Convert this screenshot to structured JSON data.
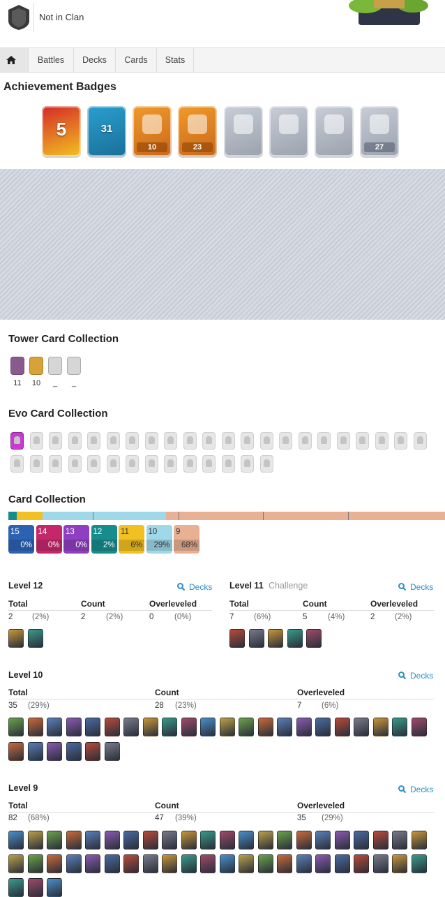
{
  "profile": {
    "clan_label": "Not in Clan"
  },
  "nav": {
    "tabs": [
      {
        "label": "Battles"
      },
      {
        "label": "Decks"
      },
      {
        "label": "Cards"
      },
      {
        "label": "Stats"
      }
    ]
  },
  "achievements": {
    "title": "Achievement Badges",
    "badges": [
      {
        "name": "years-played-badge",
        "value": "5",
        "strip": "",
        "colors": [
          "#d42a2a",
          "#f2c21f"
        ]
      },
      {
        "name": "level-badge",
        "value": "31",
        "strip": "",
        "colors": [
          "#2a9fcf",
          "#1a6f99"
        ]
      },
      {
        "name": "cards-badge",
        "value": "",
        "strip": "10",
        "colors": [
          "#f09a2a",
          "#c9681a"
        ]
      },
      {
        "name": "crown-badge",
        "value": "",
        "strip": "23",
        "colors": [
          "#f09a2a",
          "#c9681a"
        ]
      },
      {
        "name": "king-tower-badge",
        "value": "",
        "strip": "",
        "colors": [
          "#c8cdd6",
          "#9aa2ae"
        ]
      },
      {
        "name": "collection-badge",
        "value": "",
        "strip": "",
        "colors": [
          "#c8cdd6",
          "#9aa2ae"
        ]
      },
      {
        "name": "medal-badge",
        "value": "",
        "strip": "",
        "colors": [
          "#c8cdd6",
          "#9aa2ae"
        ]
      },
      {
        "name": "deck-badge",
        "value": "",
        "strip": "27",
        "colors": [
          "#c8cdd6",
          "#9aa2ae"
        ]
      }
    ]
  },
  "tower": {
    "title": "Tower Card Collection",
    "cards": [
      {
        "label": "11",
        "color": "#8a5a8f"
      },
      {
        "label": "10",
        "color": "#d8a23a"
      },
      {
        "label": "_",
        "color": "#d6d6d6"
      },
      {
        "label": "_",
        "color": "#d6d6d6"
      }
    ]
  },
  "evo": {
    "title": "Evo Card Collection",
    "owned_color": "#c93ad0"
  },
  "collection": {
    "title": "Card Collection",
    "bar": [
      {
        "level": "15",
        "share": 0.0,
        "color": "#2d62b3"
      },
      {
        "level": "14",
        "share": 0.0,
        "color": "#c4286a"
      },
      {
        "level": "13",
        "share": 0.0,
        "color": "#8f3fc2"
      },
      {
        "level": "12",
        "share": 0.02,
        "color": "#178c8c"
      },
      {
        "level": "11",
        "share": 0.06,
        "color": "#f3c021"
      },
      {
        "level": "10",
        "share": 0.29,
        "color": "#9fd8e8"
      },
      {
        "level": "9",
        "share": 0.68,
        "color": "#e9b193"
      }
    ],
    "boxes": [
      {
        "level": "15",
        "pct": "0%",
        "color": "#2d62b3"
      },
      {
        "level": "14",
        "pct": "0%",
        "color": "#c4286a"
      },
      {
        "level": "13",
        "pct": "0%",
        "color": "#8f3fc2"
      },
      {
        "level": "12",
        "pct": "2%",
        "color": "#178c8c"
      },
      {
        "level": "11",
        "pct": "6%",
        "color": "#f3c021"
      },
      {
        "level": "10",
        "pct": "29%",
        "color": "#9fd8e8"
      },
      {
        "level": "9",
        "pct": "68%",
        "color": "#e9b193"
      }
    ]
  },
  "levels": {
    "decks_label": "Decks",
    "total_label": "Total",
    "count_label": "Count",
    "over_label": "Overleveled",
    "l12": {
      "title": "Level 12",
      "total": "2",
      "total_pct": "(2%)",
      "count": "2",
      "count_pct": "(2%)",
      "over": "0",
      "over_pct": "(0%)"
    },
    "l11": {
      "title": "Level 11",
      "sub": "Challenge",
      "total": "7",
      "total_pct": "(6%)",
      "count": "5",
      "count_pct": "(4%)",
      "over": "2",
      "over_pct": "(2%)"
    },
    "l10": {
      "title": "Level 10",
      "total": "35",
      "total_pct": "(29%)",
      "count": "28",
      "count_pct": "(23%)",
      "over": "7",
      "over_pct": "(6%)"
    },
    "l9": {
      "title": "Level 9",
      "total": "82",
      "total_pct": "(68%)",
      "count": "47",
      "count_pct": "(39%)",
      "over": "35",
      "over_pct": "(29%)"
    }
  },
  "palette": {
    "cards": [
      "#5a7fb8",
      "#c8963a",
      "#6aa24a",
      "#b84a3a",
      "#4a8fc8",
      "#8a5ab0",
      "#3a9a8a",
      "#c86a3a",
      "#7a7a8a",
      "#b8a04a",
      "#4a6aa0",
      "#a04a6a"
    ]
  }
}
